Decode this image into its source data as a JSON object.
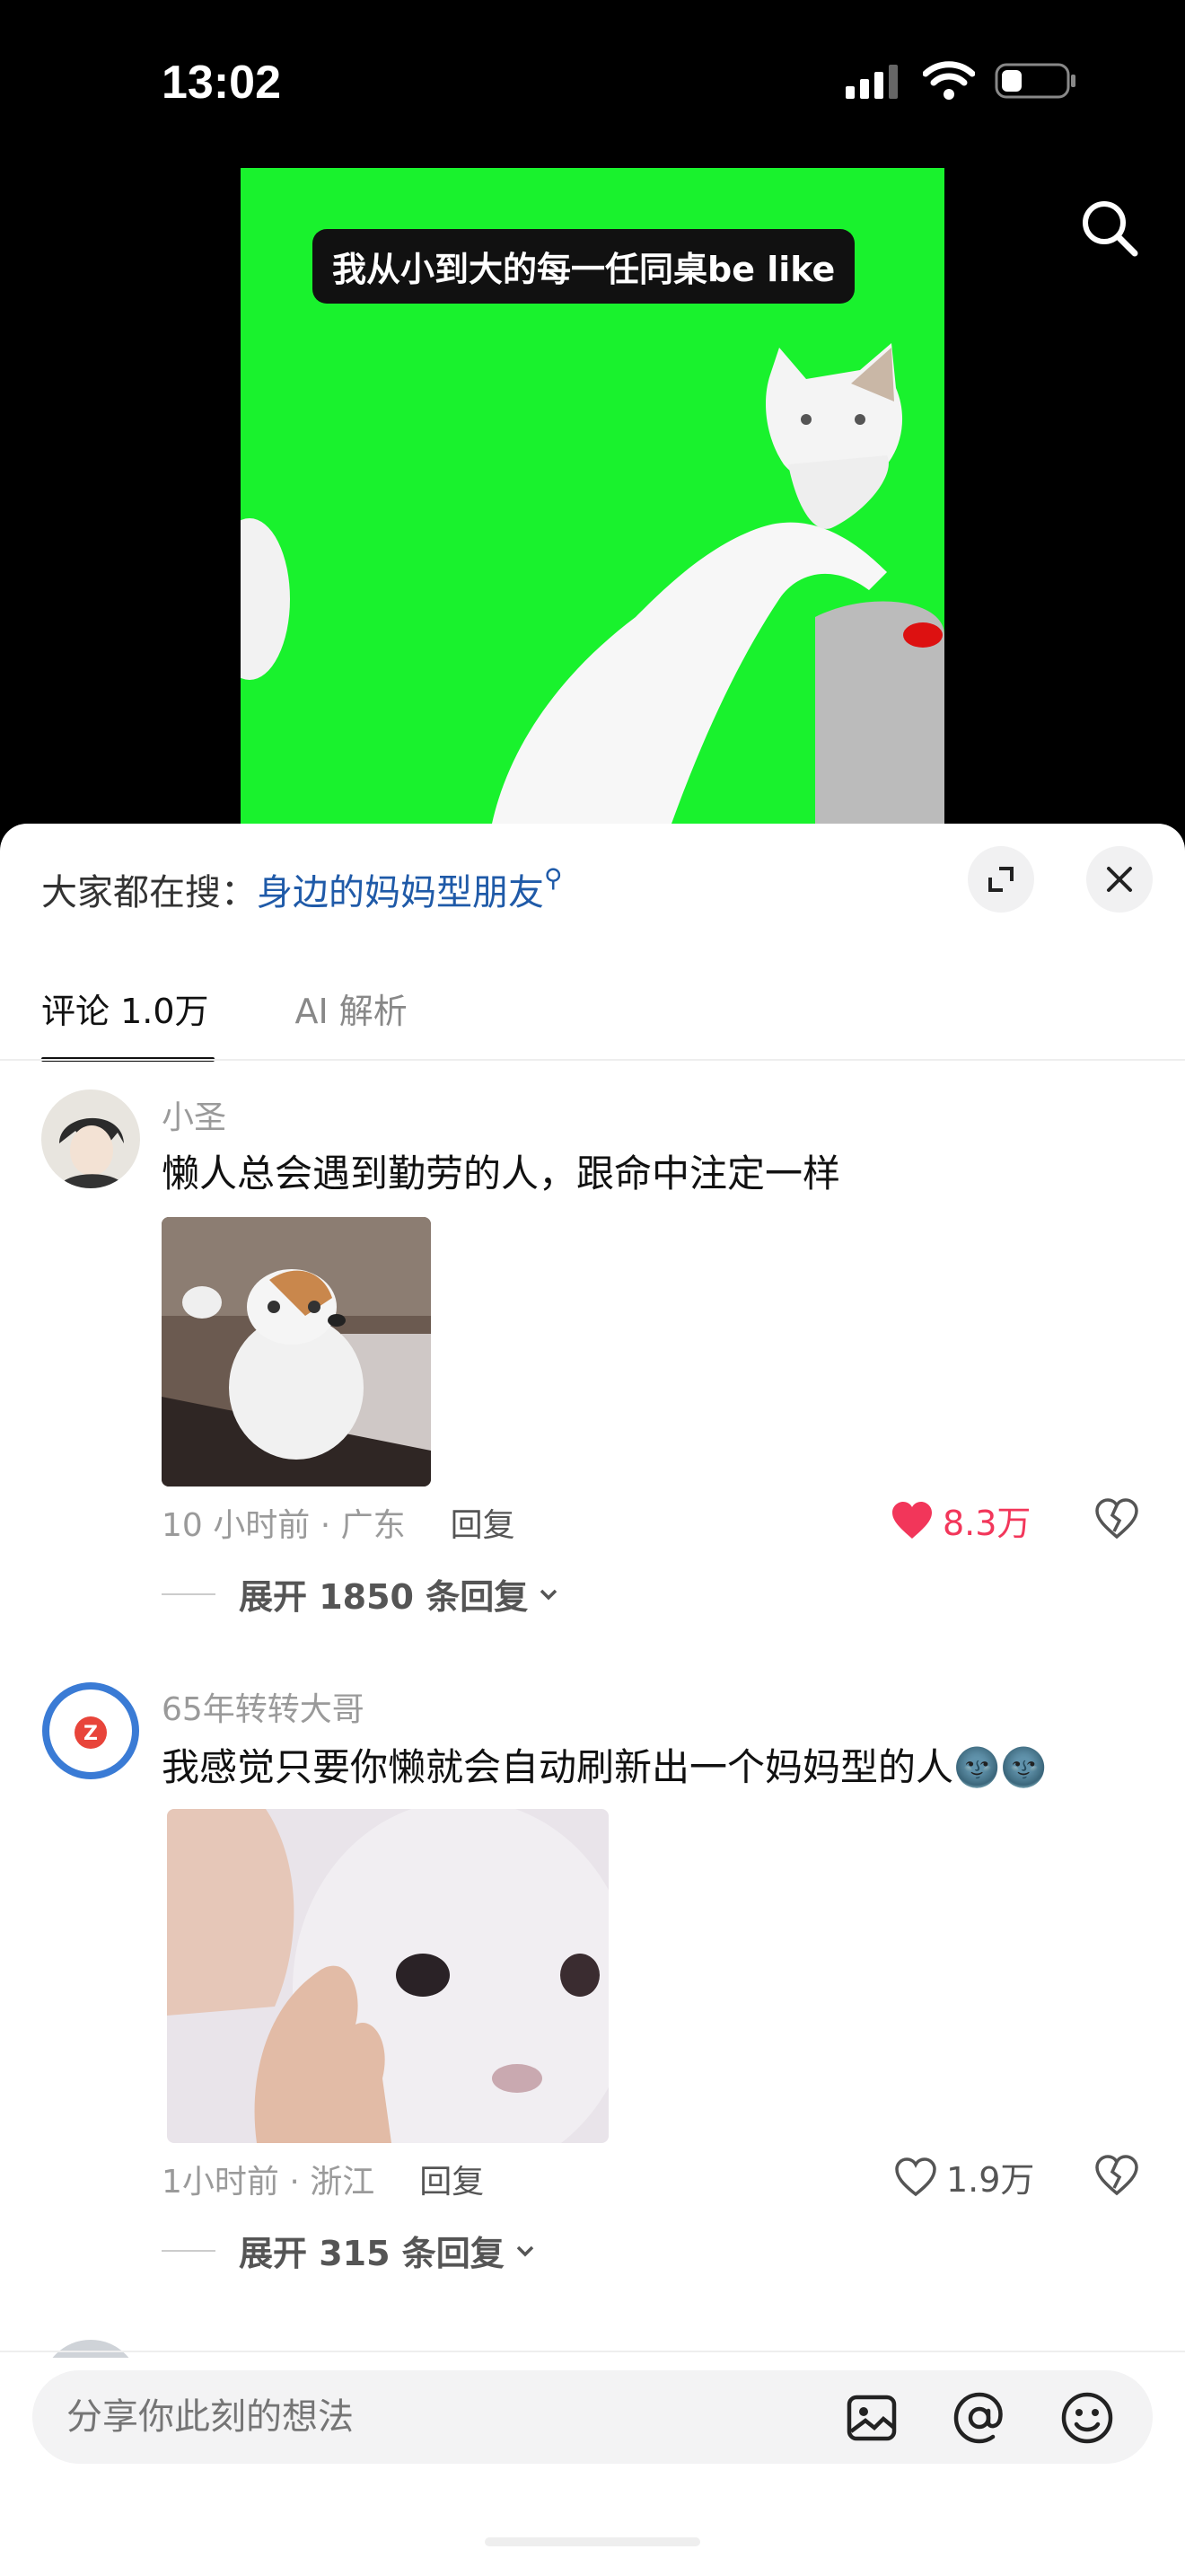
{
  "status_bar": {
    "time": "13:02"
  },
  "video": {
    "caption": "我从小到大的每一任同桌be like"
  },
  "hot_search": {
    "prefix": "大家都在搜：",
    "term": "身边的妈妈型朋友"
  },
  "tabs": [
    {
      "label": "评论 1.0万",
      "active": true
    },
    {
      "label": "AI 解析",
      "active": false
    }
  ],
  "comments": [
    {
      "user": "小圣",
      "text": "懒人总会遇到勤劳的人，跟命中注定一样",
      "meta": "10 小时前 · 广东",
      "reply_label": "回复",
      "likes": "8.3万",
      "liked": true,
      "expand": "展开 1850 条回复"
    },
    {
      "user": "65年转转大哥",
      "text": "我感觉只要你懒就会自动刷新出一个妈妈型的人🌚🌚",
      "meta": "1小时前 · 浙江",
      "reply_label": "回复",
      "likes": "1.9万",
      "liked": false,
      "expand": "展开 315 条回复"
    }
  ],
  "composer": {
    "placeholder": "分享你此刻的想法"
  },
  "colors": {
    "video_green": "#19f22d",
    "like_red": "#f2365a",
    "link_blue": "#1f5aa8"
  }
}
